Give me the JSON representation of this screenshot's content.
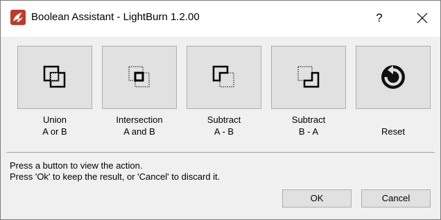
{
  "window": {
    "title": "Boolean Assistant - LightBurn 1.2.00",
    "help_label": "?",
    "close_icon": "close-icon",
    "app_icon": "lightburn-app-icon"
  },
  "operations": [
    {
      "icon": "union-icon",
      "line1": "Union",
      "line2": "A or B"
    },
    {
      "icon": "intersection-icon",
      "line1": "Intersection",
      "line2": "A and B"
    },
    {
      "icon": "subtract-a-b-icon",
      "line1": "Subtract",
      "line2": "A - B"
    },
    {
      "icon": "subtract-b-a-icon",
      "line1": "Subtract",
      "line2": "B - A"
    },
    {
      "icon": "reset-icon",
      "line1": "Reset",
      "line2": ""
    }
  ],
  "status": {
    "line1": "Press a button to view the action.",
    "line2": "Press 'Ok' to keep the result, or 'Cancel' to discard it."
  },
  "buttons": {
    "ok": "OK",
    "cancel": "Cancel"
  },
  "colors": {
    "app_icon_red": "#c0392b",
    "button_face": "#e1e1e1",
    "dialog_bg": "#f0f0f0"
  }
}
